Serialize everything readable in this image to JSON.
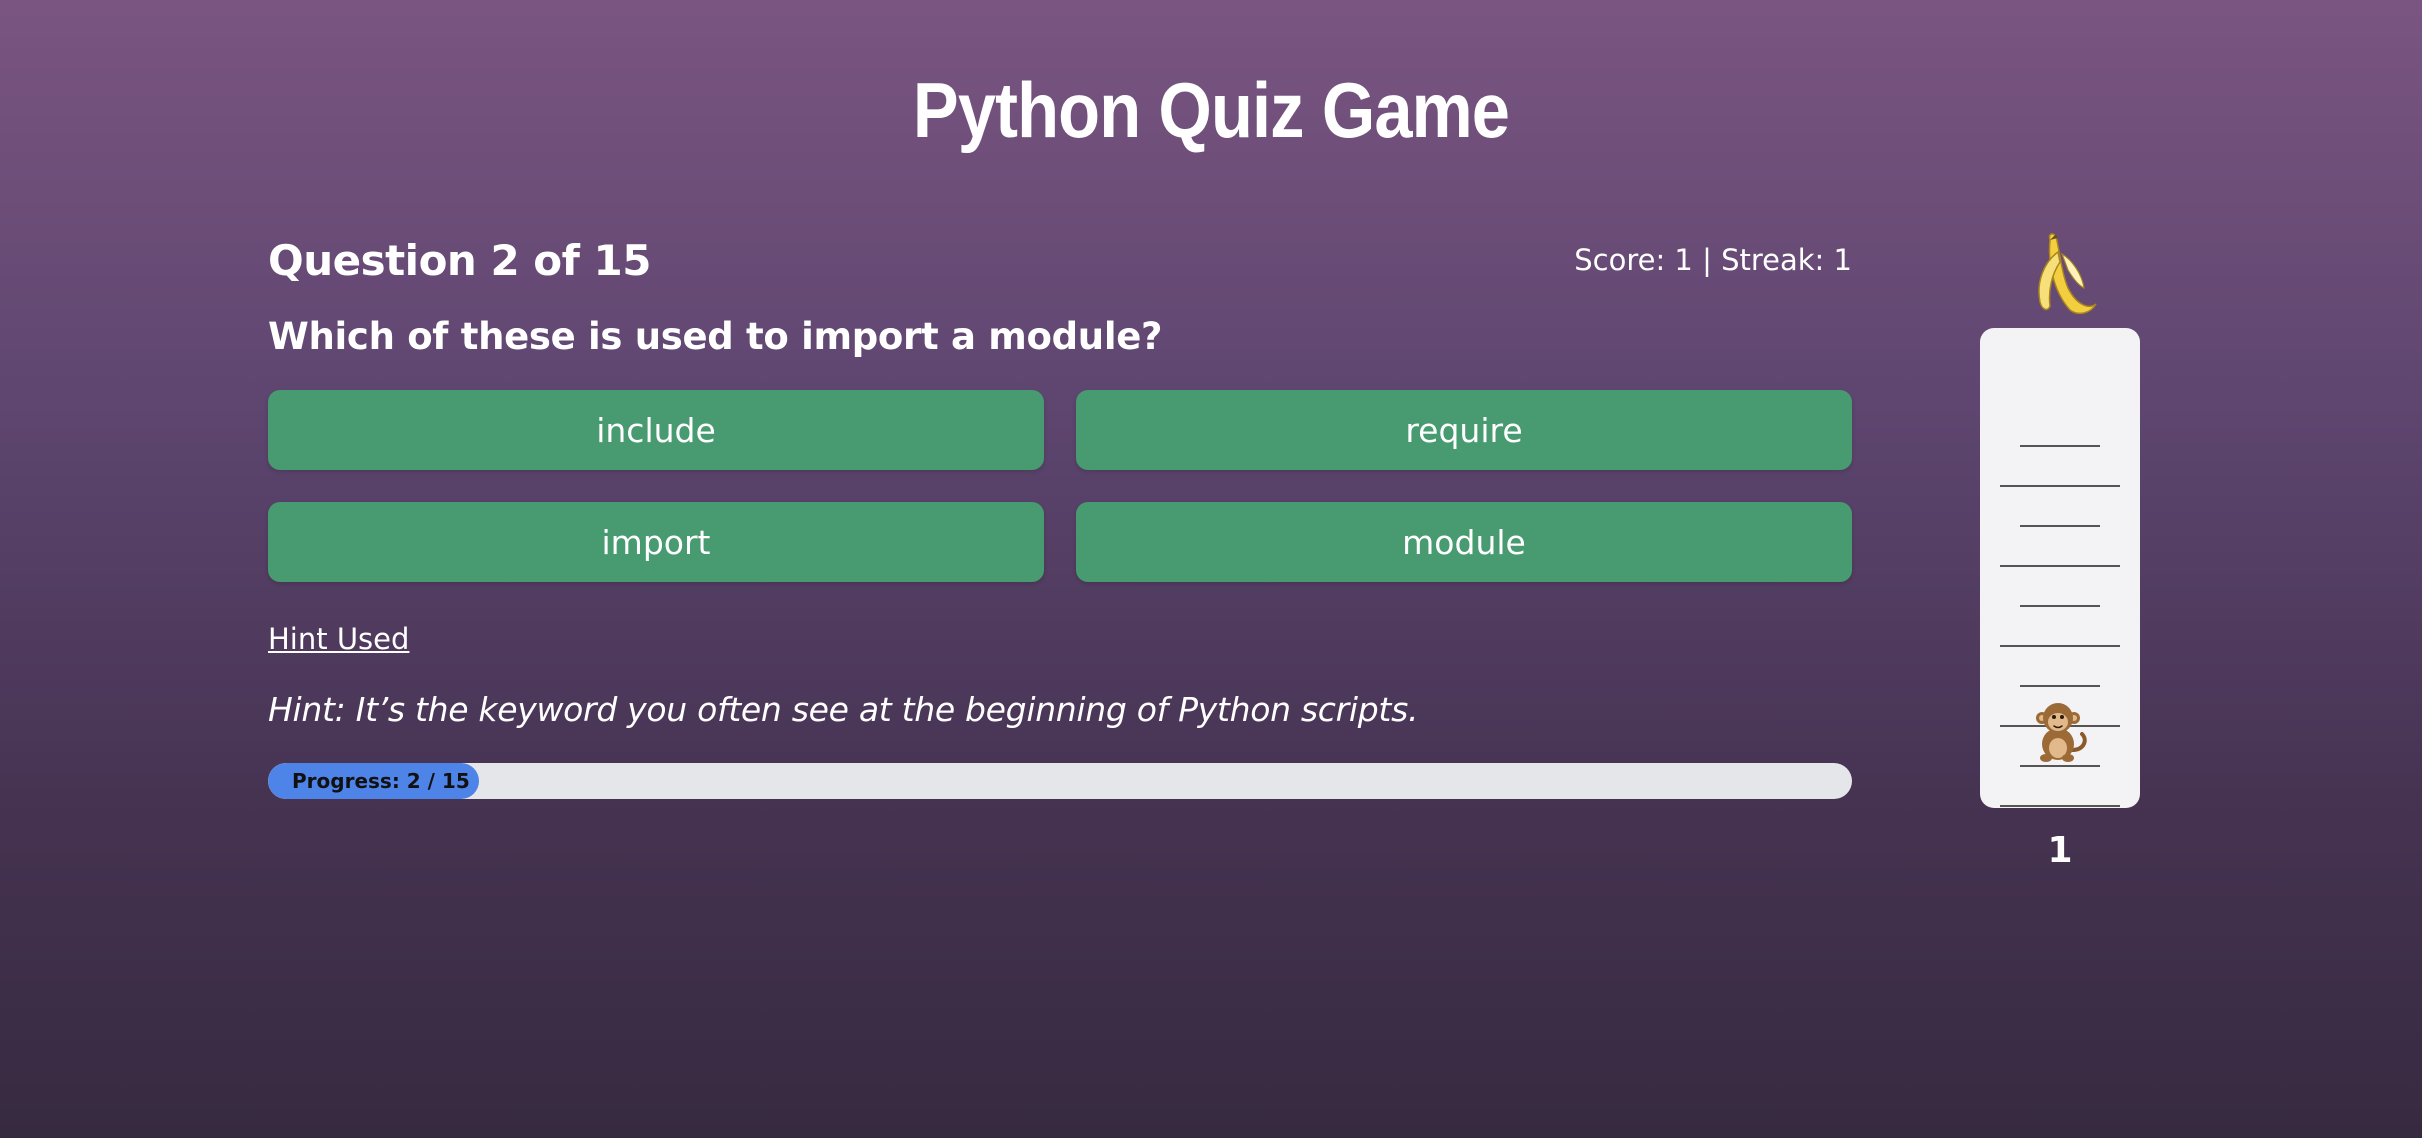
{
  "game": {
    "title": "Python Quiz Game"
  },
  "quiz": {
    "question_counter": "Question 2 of 15",
    "score_line": "Score: 1 | Streak: 1",
    "question": "Which of these is used to import a module?",
    "answers": [
      "include",
      "require",
      "import",
      "module"
    ],
    "hint_link": "Hint Used",
    "hint_text": "Hint: It’s the keyword you often see at the beginning of Python scripts.",
    "progress": {
      "label": "Progress: 2 / 15",
      "current": 2,
      "total": 15
    }
  },
  "climb": {
    "goal_icon": "banana-icon",
    "climber_icon": "monkey-icon",
    "height_value": "1"
  },
  "colors": {
    "answer_button": "#489b70",
    "progress_fill": "#4e83e8",
    "progress_track": "#e5e6ea",
    "pole": "#f3f3f5"
  }
}
